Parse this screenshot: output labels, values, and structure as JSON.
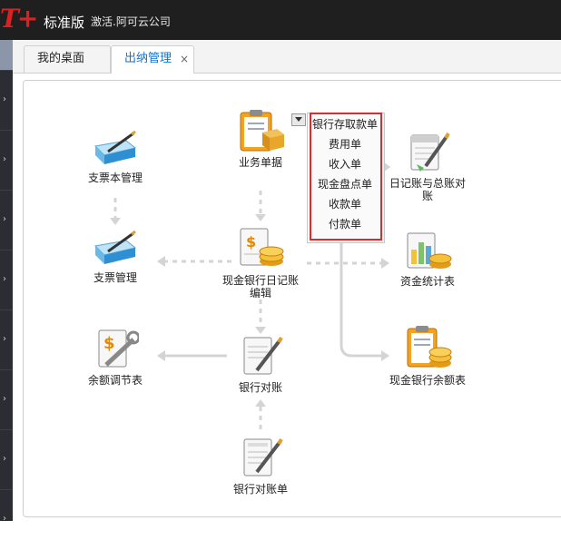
{
  "header": {
    "brand_logo": "T+",
    "brand_edition": "标准版",
    "company": "激活.阿可云公司"
  },
  "tabs": [
    {
      "label": "我的桌面"
    },
    {
      "label": "出纳管理",
      "close": "×"
    }
  ],
  "nodes": {
    "cheque_book": "支票本管理",
    "business_docs": "业务单据",
    "journal_reconcile": "日记账与总账对账",
    "cheque_manage": "支票管理",
    "cash_journal_edit": "现金银行日记账编辑",
    "fund_stats": "资金统计表",
    "balance_adjust": "余额调节表",
    "bank_reconcile": "银行对账",
    "cash_bank_balance": "现金银行余额表",
    "bank_statement": "银行对账单"
  },
  "dropdown": {
    "items": [
      "银行存取款单",
      "费用单",
      "收入单",
      "现金盘点单",
      "收款单",
      "付款单"
    ],
    "highlight_color": "#e02a2a"
  },
  "colors": {
    "header_bg": "#1f1f1f",
    "tab_active_text": "#1a73c4",
    "arrow": "#d4d4d4"
  }
}
